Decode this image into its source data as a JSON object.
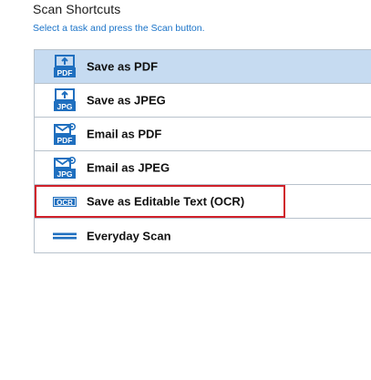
{
  "header": {
    "title": "Scan Shortcuts",
    "subtitle": "Select a task and press the Scan button."
  },
  "colors": {
    "accent": "#1a73c8",
    "selected_background": "#c6dbf1",
    "icon_blue": "#1f6fbf",
    "highlight_border": "#d0202a"
  },
  "shortcuts": [
    {
      "label": "Save as PDF",
      "icon": "save-pdf-icon",
      "icon_badge": "PDF",
      "selected": true
    },
    {
      "label": "Save as JPEG",
      "icon": "save-jpeg-icon",
      "icon_badge": "JPG",
      "selected": false
    },
    {
      "label": "Email as PDF",
      "icon": "email-pdf-icon",
      "icon_badge": "PDF",
      "selected": false
    },
    {
      "label": "Email as JPEG",
      "icon": "email-jpeg-icon",
      "icon_badge": "JPG",
      "selected": false
    },
    {
      "label": "Save as Editable Text (OCR)",
      "icon": "ocr-icon",
      "icon_badge": "OCR",
      "selected": false,
      "highlighted": true
    },
    {
      "label": "Everyday Scan",
      "icon": "everyday-scan-icon",
      "selected": false
    }
  ]
}
